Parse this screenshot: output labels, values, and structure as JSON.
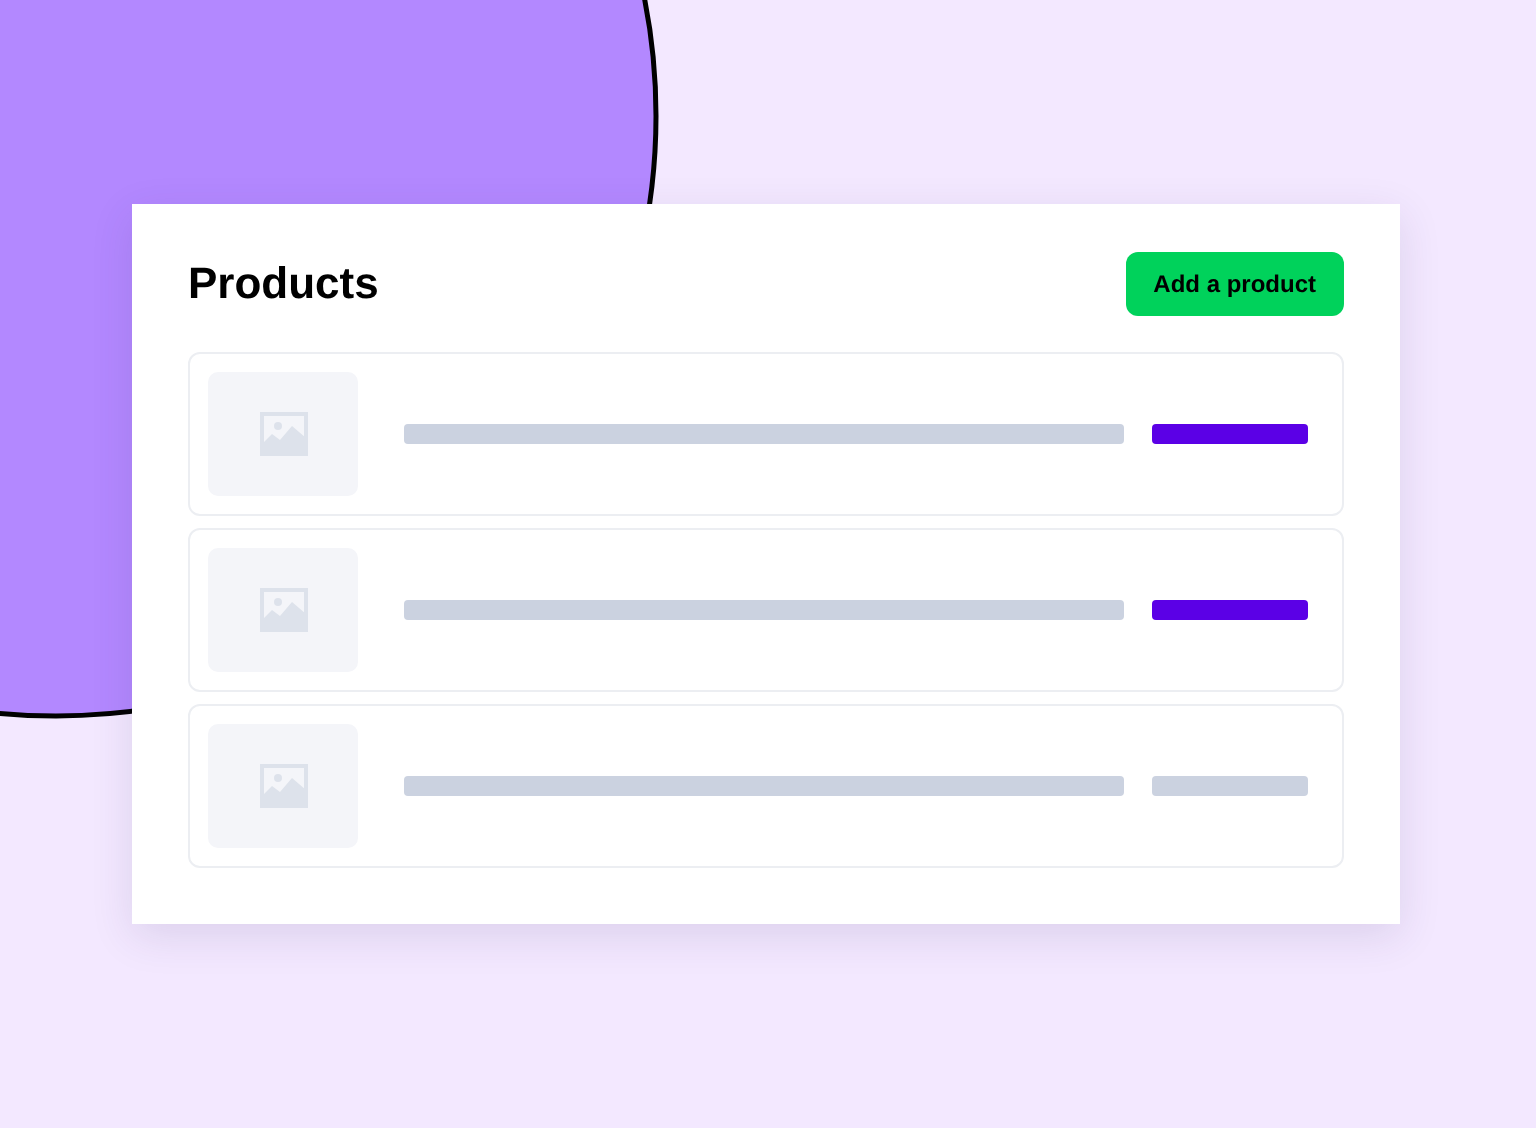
{
  "title": "Products",
  "add_button": "Add a product",
  "products": [
    {
      "color": "#5b00e6"
    },
    {
      "color": "#5b00e6"
    },
    {
      "color": "#cbd2e0"
    }
  ]
}
